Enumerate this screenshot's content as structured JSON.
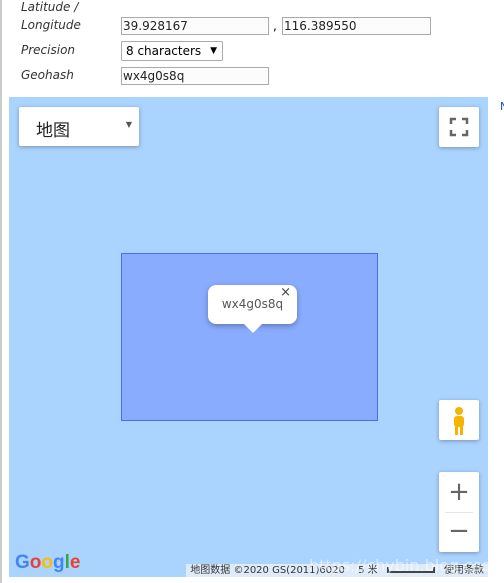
{
  "form": {
    "latlon_label_1": "Latitude /",
    "latlon_label_2": "Longitude",
    "latitude": "39.928167",
    "separator": ",",
    "longitude": "116.389550",
    "precision_label": "Precision",
    "precision_value": "8 characters",
    "geohash_label": "Geohash",
    "geohash": "wx4g0s8q"
  },
  "map": {
    "type_label": "地图",
    "info_window": "wx4g0s8q",
    "attribution": "地图数据 ©2020 GS(2011)6020",
    "scale": "5 米",
    "terms": "使用条款",
    "logo": "Google",
    "watermark": "https://chybin.blog.csdn.net",
    "colors": {
      "water": "#aad3fe",
      "cell_fill": "#8aacff",
      "cell_stroke": "#4a6ef0"
    }
  }
}
